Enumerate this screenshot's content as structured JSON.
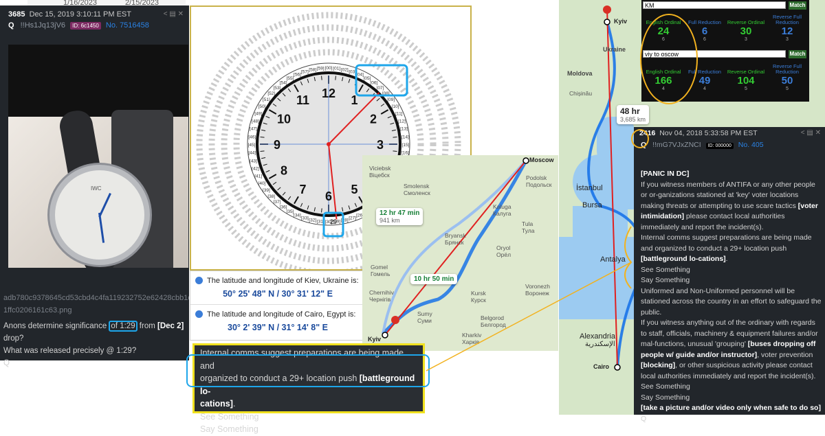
{
  "dates": {
    "d1": "1/16/2023",
    "d2": "2/15/2023"
  },
  "post_left": {
    "number": "3685",
    "datetime": "Dec 15, 2019 3:10:11 PM EST",
    "author": "Q",
    "trip": "!!Hs1Jq13jV6",
    "id_label": "ID: 6c1450",
    "post_no": "No. 7516458",
    "watch_brand": "IWC",
    "filename_line1": "adb780c9378645cd53cbd4c4fa119232752e62428cbb1d2f",
    "filename_line2": "1ffc0206161c63.png",
    "text_pre": "Anons determine significance ",
    "text_hl": "of 1:29",
    "text_post": " from ",
    "text_bold": "[Dec 2]",
    "text_end": " drop?",
    "line2": "What was released precisely @ 1:29?",
    "sign": "Q"
  },
  "clock": {
    "hours": [
      "12",
      "1",
      "2",
      "3",
      "4",
      "5",
      "6",
      "7",
      "8",
      "9",
      "10",
      "11"
    ],
    "ring_inner": [
      "[00]",
      "[01]",
      "[02]",
      "[03]",
      "[04]",
      "[05]",
      "[06]",
      "[07]",
      "[08]",
      "[09]",
      "[10]",
      "[11]"
    ],
    "ring_label_29": "29"
  },
  "latlong": {
    "q1": "The latitude and longitude of Kiev, Ukraine is:",
    "a1": "50° 25' 48\" N  /  30° 31' 12\" E",
    "q2": "The latitude and longitude of Cairo, Egypt is:",
    "a2": "30° 2' 39\" N  /  31° 14' 8\" E"
  },
  "quote": {
    "l1": "Internal comms suggest preparations are being made and",
    "l2a": "organized to conduct a 29+ location push ",
    "l2b": "[battleground lo-",
    "l3a": "cations]",
    "l3b": ".",
    "l4": "See Something",
    "l5": "Say Something"
  },
  "map_small": {
    "moscow": "Moscow",
    "kyiv": "Kyiv",
    "eta1_time": "12 hr 47 min",
    "eta1_dist": "941 km",
    "eta2_time": "10 hr 50 min",
    "labels": [
      "Viciebsk",
      "Віцебск",
      "Smolensk",
      "Смоленск",
      "Kaluga",
      "Калуга",
      "Tula",
      "Тула",
      "Podolsk",
      "Подольск",
      "Bryansk",
      "Брянск",
      "Oryol",
      "Орёл",
      "Gomel",
      "Гомель",
      "Chernihiv",
      "Чернігів",
      "Kursk",
      "Курск",
      "Sumy",
      "Суми",
      "Voronezh",
      "Воронеж",
      "Belgorod",
      "Белгород",
      "Kharkiv",
      "Харків"
    ]
  },
  "map_big": {
    "kyiv": "Kyiv",
    "ukraine": "Ukraine",
    "moldova": "Moldova",
    "chisinau": "Chișinău",
    "eta_time": "48 hr",
    "eta_dist": "3,685 km",
    "istanbul": "İstanbul",
    "bursa": "Bursa",
    "antalya": "Antalya",
    "alexandria": "Alexandria",
    "alexandria_ar": "الإسكندرية",
    "cairo": "Cairo"
  },
  "gematria": {
    "input1": "KM",
    "input2": "viy to oscow",
    "match": "Match",
    "headers": [
      "English Ordinal",
      "Full Reduction",
      "Reverse Ordinal",
      "Reverse Full Reduction"
    ],
    "row1": {
      "values": [
        "24",
        "6",
        "30",
        "12"
      ],
      "subs": [
        "6",
        "6",
        "3",
        "3"
      ]
    },
    "row2": {
      "values": [
        "166",
        "49",
        "104",
        "50"
      ],
      "subs": [
        "4",
        "4",
        "5",
        "5"
      ]
    },
    "colors": [
      "#33cc33",
      "#3b7dd8",
      "#33cc33",
      "#3b7dd8"
    ]
  },
  "post_right": {
    "number": "2416",
    "datetime": "Nov 04, 2018 5:33:58 PM EST",
    "author": "Q",
    "trip": "!!mG7VJxZNCI",
    "id_label": "ID: 000000",
    "post_no": "No. 405",
    "title": "[PANIC IN DC]",
    "p1": "If you witness members of ANTIFA or any other people or or-ganizations stationed at 'key' voter locations making threats or attempting to use scare tactics ",
    "p1b": "[voter intimidation]",
    "p1c": " please contact local authorities immediately and report the incident(s).",
    "p2": "Internal comms suggest preparations are being made and organized to conduct a 29+ location push ",
    "p2b": "[battleground lo-cations]",
    "p2c": ".",
    "see": "See Something",
    "say": "Say Something",
    "p3": "Uniformed and Non-Uniformed personnel will be stationed across the country in an effort to safeguard the public.",
    "p4": "If you witness anything out of the ordinary with regards to staff, officials, machinery & equipment failures and/or mal-functions, unusual 'grouping' ",
    "p4b": "[buses dropping off people w/ guide and/or instructor]",
    "p4c": ", voter prevention ",
    "p4d": "[blocking]",
    "p4e": ", or other suspicious activity please contact local authorities immediately and report the incident(s).",
    "see2": "See Something",
    "say2": "Say Something",
    "p5": "[take a picture and/or video only when safe to do so]",
    "sign": "Q"
  }
}
